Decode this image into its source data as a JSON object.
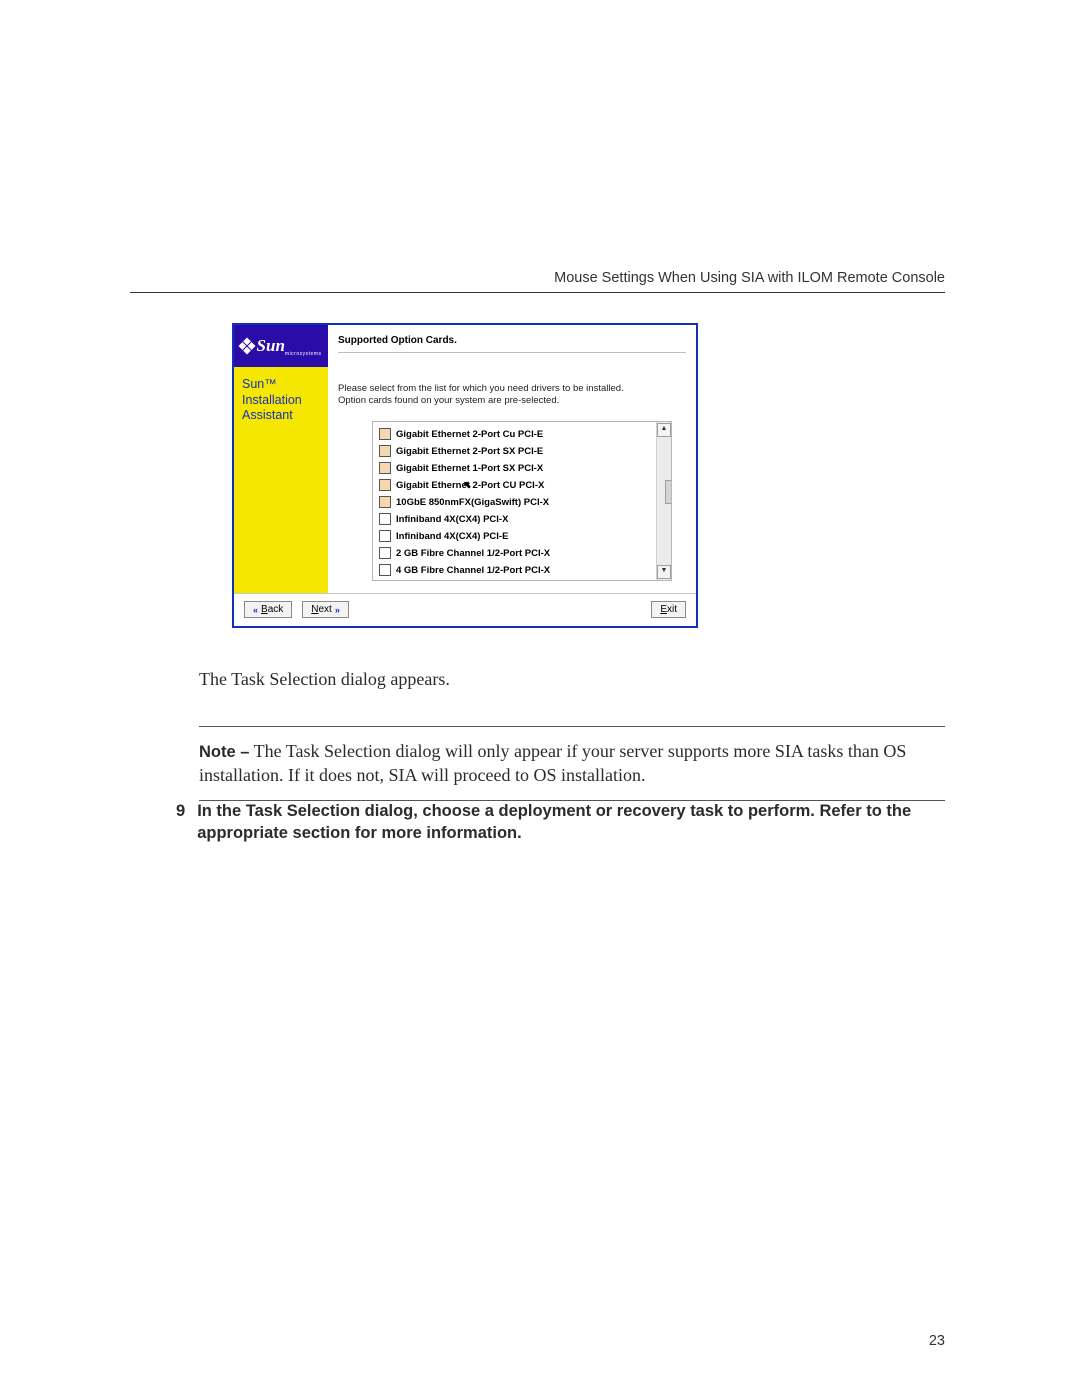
{
  "header": {
    "running_head": "Mouse Settings When Using SIA with ILOM Remote Console"
  },
  "dialog": {
    "logo": {
      "brand": "Sun",
      "sub": "microsystems"
    },
    "sidebar_title_line1": "Sun™",
    "sidebar_title_line2": "Installation",
    "sidebar_title_line3": "Assistant",
    "heading": "Supported Option Cards.",
    "instructions_line1": "Please select from the list for which you need drivers to be installed.",
    "instructions_line2": "Option cards found on your system are pre-selected.",
    "options": [
      {
        "label": "Gigabit Ethernet 2-Port Cu PCI-E",
        "preselected": true,
        "cursor": false
      },
      {
        "label": "Gigabit Ethernet 2-Port SX PCI-E",
        "preselected": true,
        "cursor": false
      },
      {
        "label": "Gigabit Ethernet 1-Port SX PCI-X",
        "preselected": true,
        "cursor": false
      },
      {
        "label": "Gigabit Ethernet 2-Port CU PCI-X",
        "preselected": true,
        "cursor": true
      },
      {
        "label": "10GbE 850nmFX(GigaSwift) PCI-X",
        "preselected": true,
        "cursor": false
      },
      {
        "label": "Infiniband 4X(CX4) PCI-X",
        "preselected": false,
        "cursor": false
      },
      {
        "label": "Infiniband 4X(CX4) PCI-E",
        "preselected": false,
        "cursor": false
      },
      {
        "label": "2 GB Fibre Channel 1/2-Port PCI-X",
        "preselected": false,
        "cursor": false
      },
      {
        "label": "4 GB Fibre Channel 1/2-Port PCI-X",
        "preselected": false,
        "cursor": false
      }
    ],
    "buttons": {
      "back_prefix": "B",
      "back_rest": "ack",
      "next_prefix": "N",
      "next_rest": "ext",
      "exit_prefix": "E",
      "exit_rest": "xit"
    }
  },
  "body": {
    "para1": "The Task Selection dialog appears.",
    "note_label": "Note –",
    "note_text": " The Task Selection dialog will only appear if your server supports more SIA tasks than OS installation. If it does not, SIA will proceed to OS installation.",
    "step_num": "9",
    "step_text": "In the Task Selection dialog, choose a deployment or recovery task to perform. Refer to the appropriate section for more information."
  },
  "page_number": "23"
}
